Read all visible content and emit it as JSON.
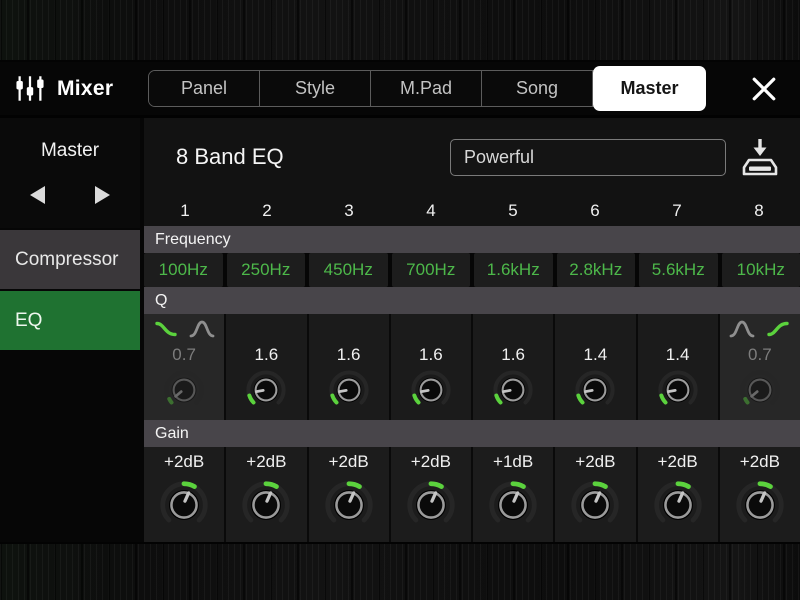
{
  "header": {
    "title": "Mixer",
    "tabs": [
      "Panel",
      "Style",
      "M.Pad",
      "Song",
      "Master"
    ],
    "active_tab": "Master",
    "icons": {
      "app": "mixer-sliders-icon",
      "close": "close-icon"
    }
  },
  "sidebar": {
    "group_label": "Master",
    "icons": {
      "prev": "left-arrow-icon",
      "next": "right-arrow-icon"
    },
    "items": [
      "Compressor",
      "EQ"
    ],
    "active_item": "EQ"
  },
  "main": {
    "title": "8 Band EQ",
    "preset": "Powerful",
    "icons": {
      "save": "save-icon"
    },
    "section_labels": {
      "frequency": "Frequency",
      "q": "Q",
      "gain": "Gain"
    },
    "bands": [
      {
        "number": "1",
        "frequency": "100Hz",
        "q": "0.7",
        "gain": "+2dB",
        "q_disabled": true,
        "filter_shape": "low-shelf"
      },
      {
        "number": "2",
        "frequency": "250Hz",
        "q": "1.6",
        "gain": "+2dB"
      },
      {
        "number": "3",
        "frequency": "450Hz",
        "q": "1.6",
        "gain": "+2dB"
      },
      {
        "number": "4",
        "frequency": "700Hz",
        "q": "1.6",
        "gain": "+2dB"
      },
      {
        "number": "5",
        "frequency": "1.6kHz",
        "q": "1.6",
        "gain": "+1dB"
      },
      {
        "number": "6",
        "frequency": "2.8kHz",
        "q": "1.4",
        "gain": "+2dB"
      },
      {
        "number": "7",
        "frequency": "5.6kHz",
        "q": "1.4",
        "gain": "+2dB"
      },
      {
        "number": "8",
        "frequency": "10kHz",
        "q": "0.7",
        "gain": "+2dB",
        "q_disabled": true,
        "filter_shape": "high-shelf"
      }
    ],
    "colors": {
      "accent_green": "#5bd23d",
      "frequency_text": "#4db84a",
      "active_item_bg": "#1f7231"
    }
  }
}
